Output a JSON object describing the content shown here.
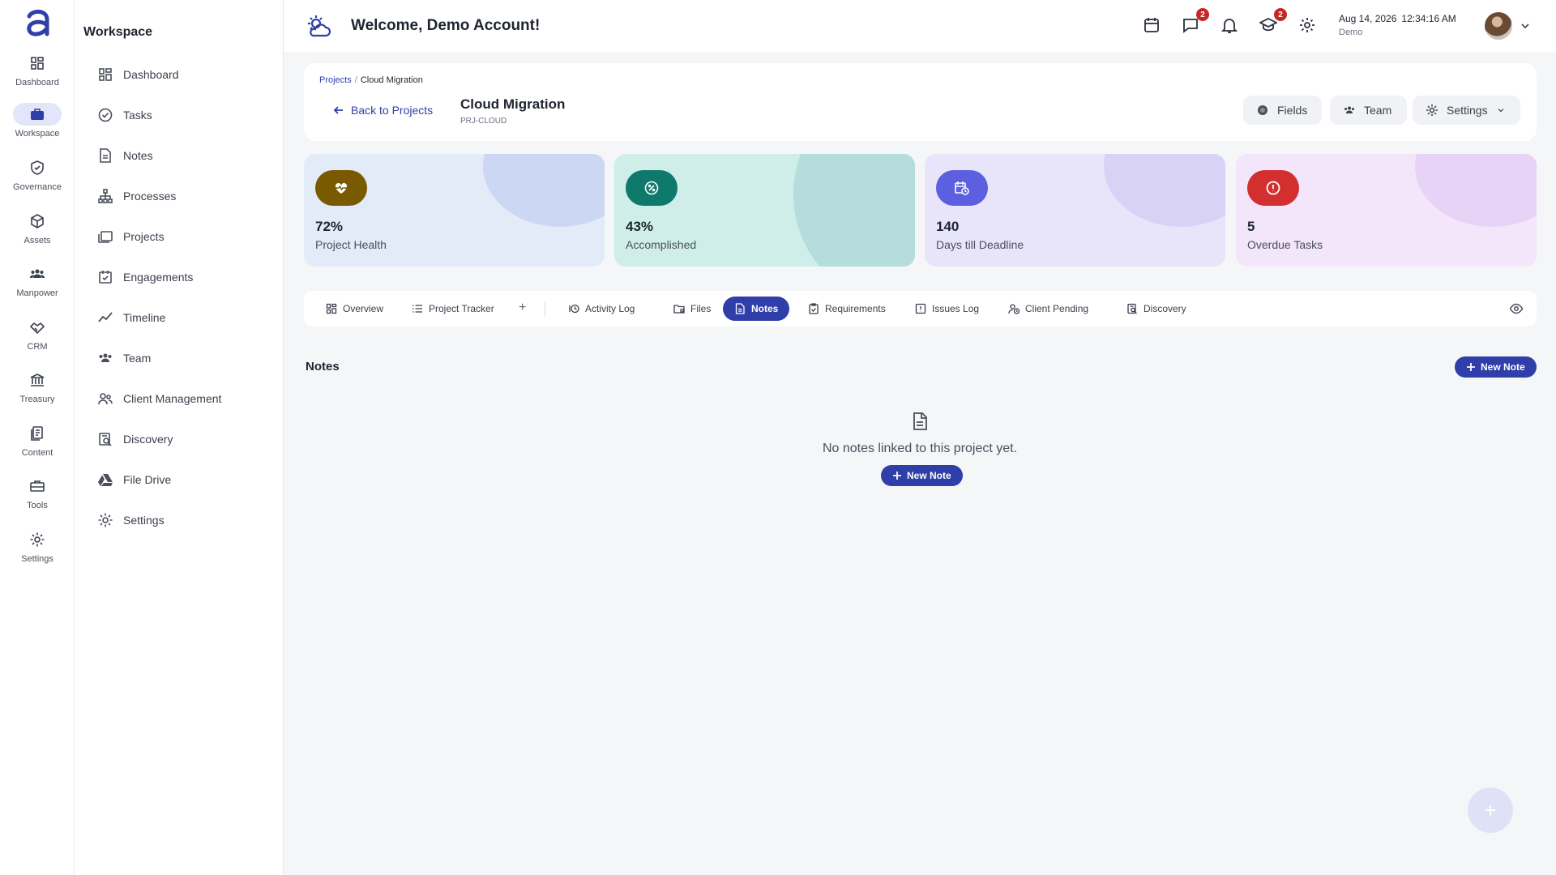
{
  "rail": {
    "items": [
      {
        "label": "Dashboard",
        "icon": "grid-icon"
      },
      {
        "label": "Workspace",
        "icon": "briefcase-icon"
      },
      {
        "label": "Governance",
        "icon": "shield-icon"
      },
      {
        "label": "Assets",
        "icon": "cube-icon"
      },
      {
        "label": "Manpower",
        "icon": "people-icon"
      },
      {
        "label": "CRM",
        "icon": "handshake-icon"
      },
      {
        "label": "Treasury",
        "icon": "bank-icon"
      },
      {
        "label": "Content",
        "icon": "document-icon"
      },
      {
        "label": "Tools",
        "icon": "toolbox-icon"
      },
      {
        "label": "Settings",
        "icon": "gear-icon"
      }
    ]
  },
  "sidebar": {
    "title": "Workspace",
    "items": [
      {
        "label": "Dashboard"
      },
      {
        "label": "Tasks"
      },
      {
        "label": "Notes"
      },
      {
        "label": "Processes"
      },
      {
        "label": "Projects"
      },
      {
        "label": "Engagements"
      },
      {
        "label": "Timeline"
      },
      {
        "label": "Team"
      },
      {
        "label": "Client Management"
      },
      {
        "label": "Discovery"
      },
      {
        "label": "File Drive"
      },
      {
        "label": "Settings"
      }
    ]
  },
  "header": {
    "title": "Welcome, Demo Account!",
    "messages_badge": "2",
    "learning_badge": "2",
    "date": "Aug 14, 2026",
    "time": "12:34:16 AM",
    "user": "Demo"
  },
  "project": {
    "breadcrumb_root": "Projects",
    "breadcrumb_sep": "/",
    "breadcrumb_current": "Cloud Migration",
    "back_label": "Back to Projects",
    "name": "Cloud Migration",
    "code": "PRJ-CLOUD",
    "fields_label": "Fields",
    "team_label": "Team",
    "settings_label": "Settings"
  },
  "stats": [
    {
      "value": "72%",
      "label": "Project Health",
      "bg": "#e3ebf9",
      "accent": "#7a5a00"
    },
    {
      "value": "43%",
      "label": "Accomplished",
      "bg": "#cfeeea",
      "accent": "#0f7a6c"
    },
    {
      "value": "140",
      "label": "Days till Deadline",
      "bg": "#e8e5fa",
      "accent": "#5b5fe0"
    },
    {
      "value": "5",
      "label": "Overdue Tasks",
      "bg": "#f3e6fb",
      "accent": "#d32f2f"
    }
  ],
  "tabs": [
    {
      "label": "Overview"
    },
    {
      "label": "Project Tracker"
    },
    {
      "label": "Activity Log"
    },
    {
      "label": "Files"
    },
    {
      "label": "Notes"
    },
    {
      "label": "Requirements"
    },
    {
      "label": "Issues Log"
    },
    {
      "label": "Client Pending"
    },
    {
      "label": "Discovery"
    }
  ],
  "tab_add": "+",
  "notes": {
    "title": "Notes",
    "new_note": "New Note",
    "empty_text": "No notes linked to this project yet.",
    "empty_button": "New Note"
  },
  "fab_label": "+",
  "colors": {
    "primary": "#2f3ea8",
    "badge": "#c62828"
  }
}
